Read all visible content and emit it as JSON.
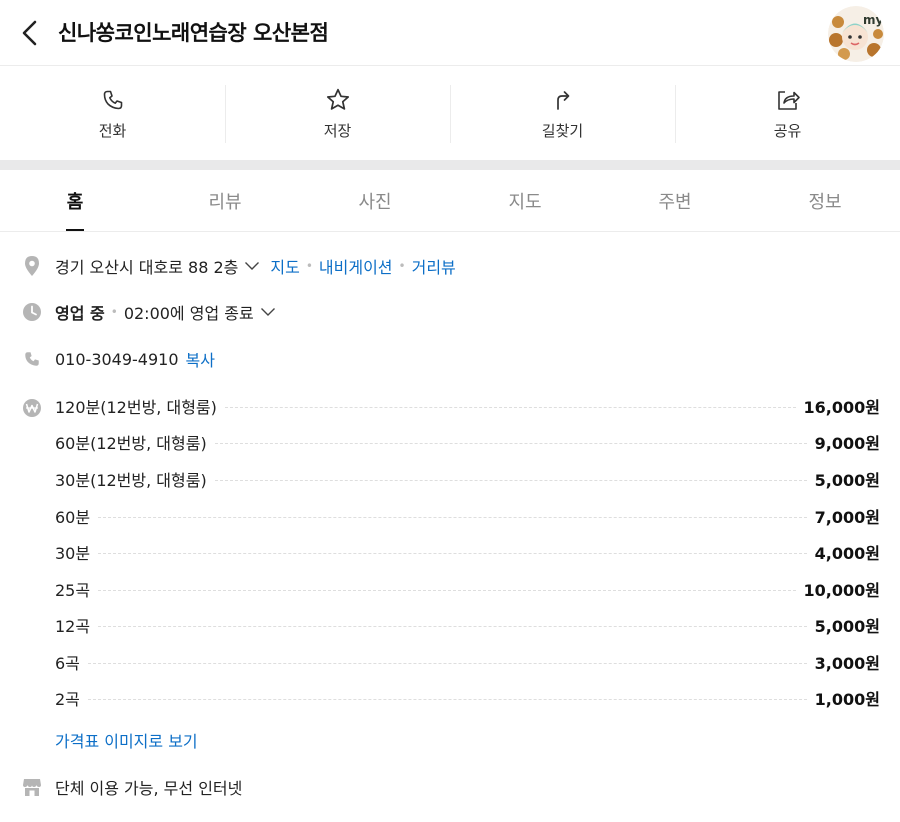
{
  "header": {
    "title": "신나쏭코인노래연습장 오산본점",
    "avatar_text": "my"
  },
  "actions": [
    {
      "label": "전화",
      "icon": "phone-icon"
    },
    {
      "label": "저장",
      "icon": "star-icon"
    },
    {
      "label": "길찾기",
      "icon": "directions-icon"
    },
    {
      "label": "공유",
      "icon": "share-icon"
    }
  ],
  "tabs": [
    {
      "label": "홈",
      "active": true
    },
    {
      "label": "리뷰"
    },
    {
      "label": "사진"
    },
    {
      "label": "지도"
    },
    {
      "label": "주변"
    },
    {
      "label": "정보"
    }
  ],
  "address": {
    "text": "경기 오산시 대호로 88 2층",
    "links": [
      "지도",
      "내비게이션",
      "거리뷰"
    ]
  },
  "hours": {
    "status": "영업 중",
    "detail": "02:00에 영업 종료"
  },
  "phone": {
    "number": "010-3049-4910",
    "copy_label": "복사"
  },
  "prices": [
    {
      "name": "120분(12번방, 대형룸)",
      "price": "16,000원"
    },
    {
      "name": "60분(12번방, 대형룸)",
      "price": "9,000원"
    },
    {
      "name": "30분(12번방, 대형룸)",
      "price": "5,000원"
    },
    {
      "name": "60분",
      "price": "7,000원"
    },
    {
      "name": "30분",
      "price": "4,000원"
    },
    {
      "name": "25곡",
      "price": "10,000원"
    },
    {
      "name": "12곡",
      "price": "5,000원"
    },
    {
      "name": "6곡",
      "price": "3,000원"
    },
    {
      "name": "2곡",
      "price": "1,000원"
    }
  ],
  "price_image_link": "가격표 이미지로 보기",
  "facilities": "단체 이용 가능, 무선 인터넷",
  "colors": {
    "link": "#0d6fc7",
    "icon_gray": "#b5b5b5"
  }
}
